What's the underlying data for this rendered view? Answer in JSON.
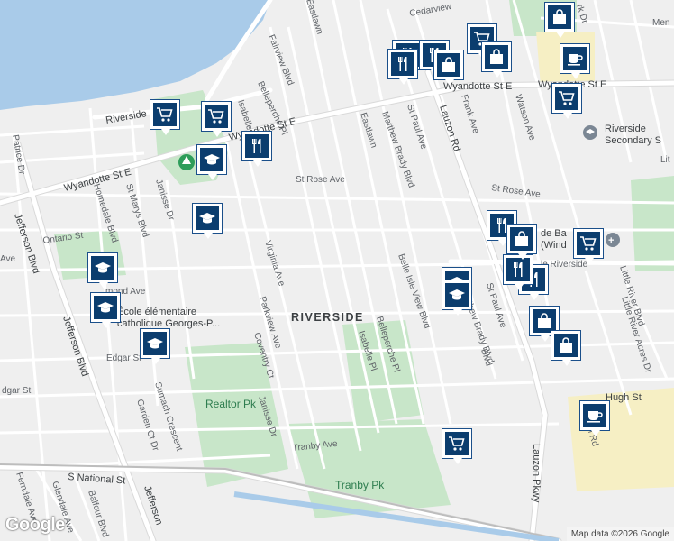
{
  "map": {
    "neighbourhood": "RIVERSIDE",
    "streets": {
      "wyandotte_w": "Wyandotte St E",
      "wyandotte_mid": "Wyandotte St E",
      "wyandotte_e": "Wyandotte St E",
      "riverside_w": "Riverside",
      "cedarview": "Cedarview",
      "st_rose": "St Rose Ave",
      "st_rose_e": "St Rose Ave",
      "tranby": "Tranby Ave",
      "hugh": "Hugh St",
      "s_national": "S National St",
      "edgar": "Edgar St",
      "edgar_w": "dgar St",
      "ontario": "Ontario St",
      "ontario_w": "Ave",
      "raymond": "mond Ave",
      "jefferson_1": "Jefferson Blvd",
      "jefferson_2": "Jefferson Blvd",
      "jefferson_3": "Jefferson",
      "patrice": "Patrice Dr",
      "homedale": "Homedale Blvd",
      "st_marys": "St Marys Blvd",
      "janisse_n": "Janisse Dr",
      "janisse_s": "Janisse Dr",
      "fairview": "Fairview Blvd",
      "eastlawn_n": "Eastlawn",
      "eastlawn": "Eastlawn",
      "belleperche_n": "Belleperche Pl",
      "belleperche_s": "Belleperche Pl",
      "isabelle_n": "Isabelle Pl",
      "isabelle_s": "Isabelle Pl",
      "virginia": "Virginia Ave",
      "parkview": "Parkview Ave",
      "coventry": "Coventry Ct",
      "matthew_brady_n": "Matthew Brady Blvd",
      "matthew_brady_s": "Matthew Brady Blvd",
      "st_paul_n": "St Paul Ave",
      "st_paul_s": "St Paul Ave",
      "belle_isle": "Belle Isle View Blvd",
      "lauzon_rd": "Lauzon Rd",
      "lauzon_pkwy": "Lauzon Pkwy",
      "frank": "Frank Ave",
      "watson": "Watson Ave",
      "little_river_acres": "Little River Acres Dr",
      "little_river_blvd": "Little River Blvd",
      "sumach": "Sumach Crescent",
      "garden_ct": "Garden Ct Dr",
      "ferndale": "Ferndale Ave",
      "glendale": "Glendale Ave",
      "balfour": "Balfour Blvd",
      "kirk": "rk Dr",
      "men": "Men",
      "lauzon_rd_se": "on Rd",
      "lit": "Lit",
      "blvd_snippet": "Blvd",
      "fram_ave": "Ave",
      "riverside_dr_e": "le Riverside"
    },
    "places": {
      "school_fr_line1": "École élémentaire",
      "school_fr_line2": "catholique Georges-P...",
      "riverside_secondary_1": "Riverside",
      "riverside_secondary_2": "Secondary S",
      "bank_line1": "de Ba",
      "bank_line2": "(Wind",
      "realtor_pk": "Realtor Pk",
      "tranby_pk": "Tranby Pk"
    },
    "pin_types": [
      "restaurant-icon",
      "shopping-cart-icon",
      "shopping-bag-icon",
      "school-icon",
      "cafe-icon",
      "park-icon"
    ],
    "colors": {
      "water": "#a9cbe9",
      "park": "#c8e6c9",
      "pin_fill": "#0b3d6e",
      "road": "#ffffff",
      "land": "#efefef"
    },
    "logo": "Google",
    "attribution": "Map data ©2026 Google"
  }
}
